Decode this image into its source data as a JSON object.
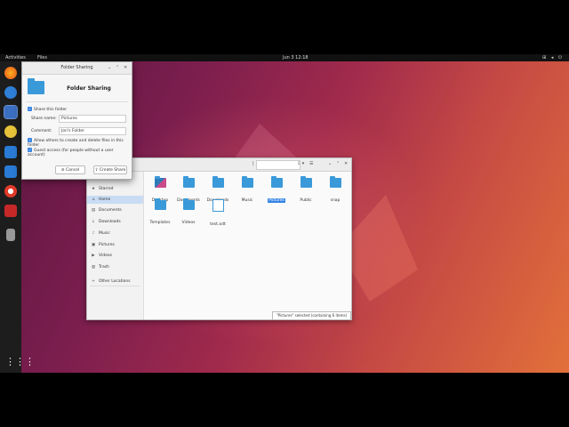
{
  "topbar": {
    "activities": "Activities",
    "app_name": "Files",
    "clock": "Jun 3  12:18",
    "tray": "⊞ ◂ ⏻"
  },
  "dock": {
    "apps_grid_icon": "⋮⋮⋮"
  },
  "files": {
    "path": "",
    "sidebar": [
      {
        "icon": "star-icon",
        "glyph": "★",
        "label": "Starred"
      },
      {
        "icon": "home-icon",
        "glyph": "⌂",
        "label": "Home"
      },
      {
        "icon": "document-icon",
        "glyph": "▤",
        "label": "Documents"
      },
      {
        "icon": "download-icon",
        "glyph": "↓",
        "label": "Downloads"
      },
      {
        "icon": "music-icon",
        "glyph": "♪",
        "label": "Music"
      },
      {
        "icon": "picture-icon",
        "glyph": "▣",
        "label": "Pictures"
      },
      {
        "icon": "video-icon",
        "glyph": "▶",
        "label": "Videos"
      },
      {
        "icon": "trash-icon",
        "glyph": "▥",
        "label": "Trash"
      },
      {
        "icon": "plus-icon",
        "glyph": "+",
        "label": "Other Locations"
      }
    ],
    "items": [
      {
        "label": "Desktop"
      },
      {
        "label": "Documents"
      },
      {
        "label": "Downloads"
      },
      {
        "label": "Music"
      },
      {
        "label": "Pictures"
      },
      {
        "label": "Public"
      },
      {
        "label": "snap"
      },
      {
        "label": "Templates"
      },
      {
        "label": "Videos"
      },
      {
        "label": "test.odt"
      }
    ],
    "status": "\"Pictures\" selected (containing 6 items)"
  },
  "share": {
    "window_title": "Folder Sharing",
    "heading": "Folder Sharing",
    "share_checkbox": "Share this folder",
    "share_name_label": "Share name:",
    "share_name_value": "Pictures",
    "comment_label": "Comment:",
    "comment_value": "Jon's Folder",
    "allow_checkbox": "Allow others to create and delete files in this folder",
    "guest_checkbox": "Guest access (for people without a user account)",
    "cancel_label": "Cancel",
    "create_label": "Create Share"
  },
  "colors": {
    "accent": "#3584e4",
    "folder": "#3a99d9",
    "dock": "#1d1d1d"
  }
}
